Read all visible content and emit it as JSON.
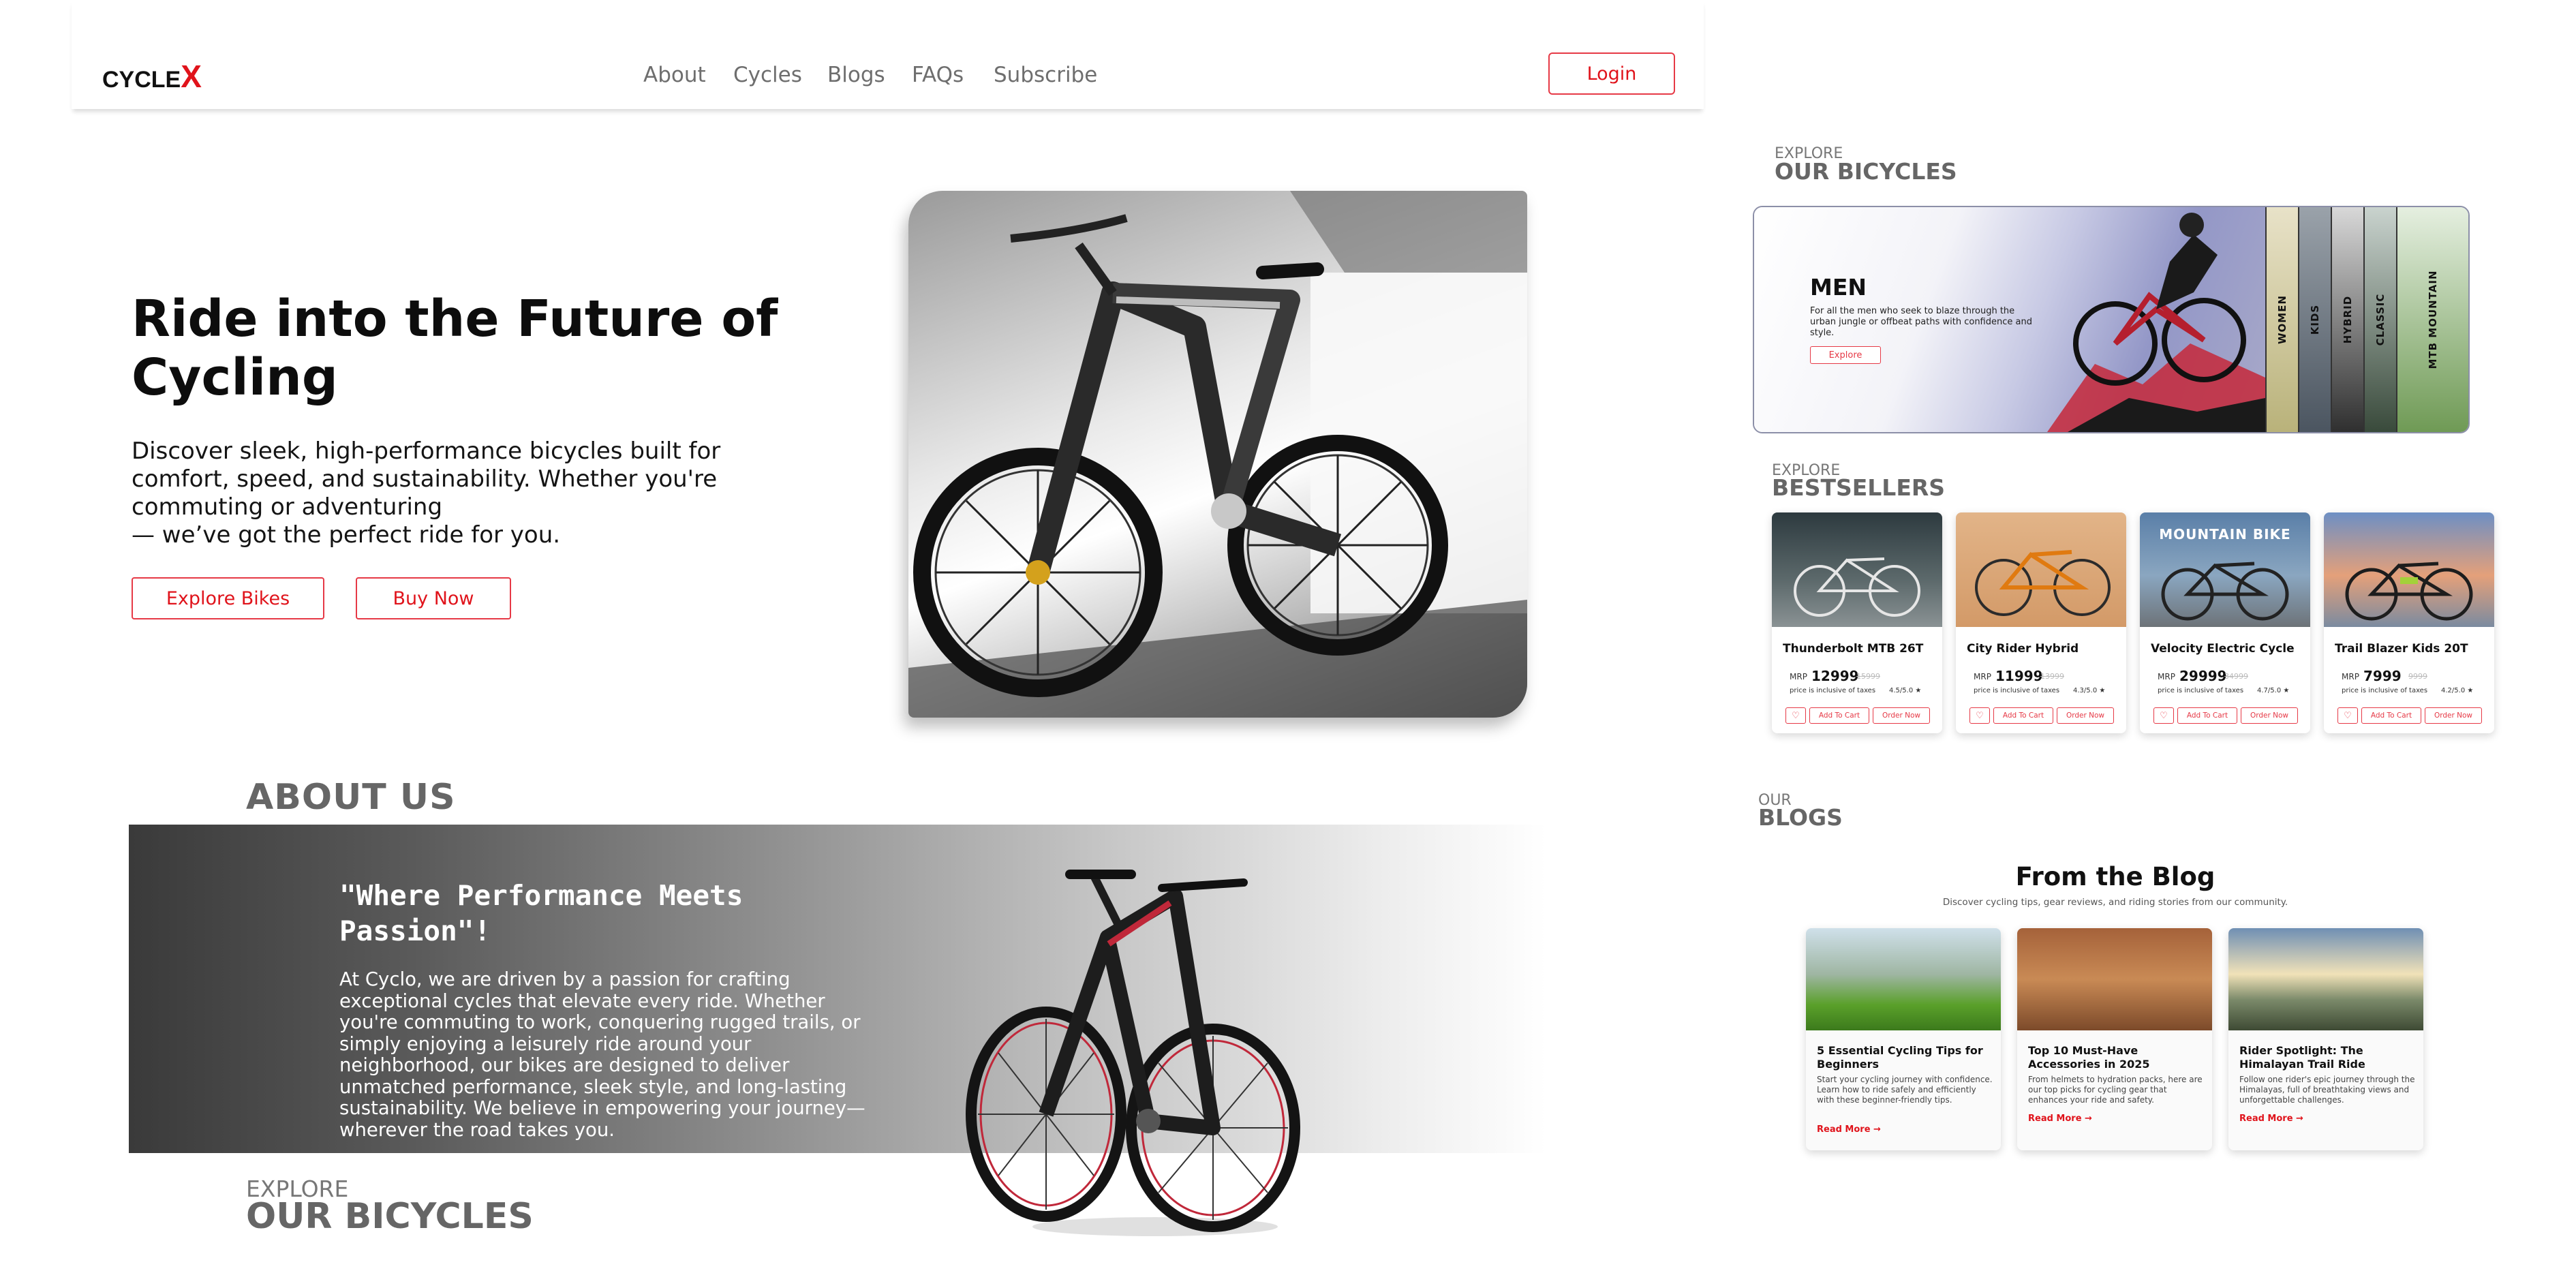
{
  "brand": {
    "name": "CYCLE",
    "mark": "X"
  },
  "nav": {
    "items": [
      "About",
      "Cycles",
      "Blogs",
      "FAQs",
      "Subscribe"
    ],
    "login": "Login"
  },
  "hero": {
    "title": "Ride into the Future of Cycling",
    "subtitle_lines": [
      "Discover sleek, high-performance bicycles built for",
      "comfort, speed, and sustainability. Whether you're",
      "commuting or adventuring",
      "— we’ve got the perfect ride for you."
    ],
    "explore_btn": "Explore Bikes",
    "buy_btn": "Buy Now"
  },
  "about": {
    "heading": "ABOUT US",
    "quote": "\"Where Performance Meets Passion\"!",
    "text": "At Cyclo, we are driven by a passion for crafting exceptional cycles that elevate every ride. Whether you're commuting to work, conquering rugged trails, or simply enjoying a leisurely ride around your neighborhood, our bikes are designed to deliver unmatched performance, sleek style, and long-lasting sustainability. We believe in empowering your journey—wherever the road takes you."
  },
  "explore_section": {
    "kicker": "EXPLORE",
    "heading": "OUR BICYCLES"
  },
  "carousel": {
    "kicker": "EXPLORE",
    "heading": "OUR BICYCLES",
    "active": {
      "title": "MEN",
      "description": "For all the men who seek to blaze through the urban jungle or offbeat paths with confidence and style.",
      "button": "Explore"
    },
    "strips": [
      "WOMEN",
      "KIDS",
      "HYBRID",
      "CLASSIC",
      "MTB MOUNTAIN"
    ]
  },
  "bestsellers": {
    "kicker": "EXPLORE",
    "heading": "BESTSELLERS",
    "mrp_label": "MRP",
    "tax_note": "price is inclusive of taxes",
    "add_label": "Add To Cart",
    "order_label": "Order Now",
    "heart_icon": "♡",
    "products": [
      {
        "name": "Thunderbolt MTB 26T",
        "price": "12999",
        "old": "15999",
        "rating": "4.5/5.0 ★"
      },
      {
        "name": "City Rider Hybrid",
        "price": "11999",
        "old": "13999",
        "rating": "4.3/5.0 ★"
      },
      {
        "name": "Velocity Electric Cycle",
        "price": "29999",
        "old": "34999",
        "rating": "4.7/5.0 ★",
        "image_text": "MOUNTAIN BIKE"
      },
      {
        "name": "Trail Blazer Kids 20T",
        "price": "7999",
        "old": "9999",
        "rating": "4.2/5.0 ★"
      }
    ]
  },
  "blogs": {
    "kicker": "OUR",
    "heading": "BLOGS",
    "title": "From the Blog",
    "subtitle": "Discover cycling tips, gear reviews, and riding stories from our community.",
    "read_more": "Read More →",
    "posts": [
      {
        "title": "5 Essential Cycling Tips for Beginners",
        "body": "Start your cycling journey with confidence. Learn how to ride safely and efficiently with these beginner-friendly tips."
      },
      {
        "title": "Top 10 Must-Have Accessories in 2025",
        "body": "From helmets to hydration packs, here are our top picks for cycling gear that enhances your ride and safety."
      },
      {
        "title": "Rider Spotlight: The Himalayan Trail Ride",
        "body": "Follow one rider's epic journey through the Himalayas, full of breathtaking views and unforgettable challenges."
      }
    ]
  },
  "colors": {
    "accent": "#e0131b",
    "heading_gray": "#666666"
  }
}
